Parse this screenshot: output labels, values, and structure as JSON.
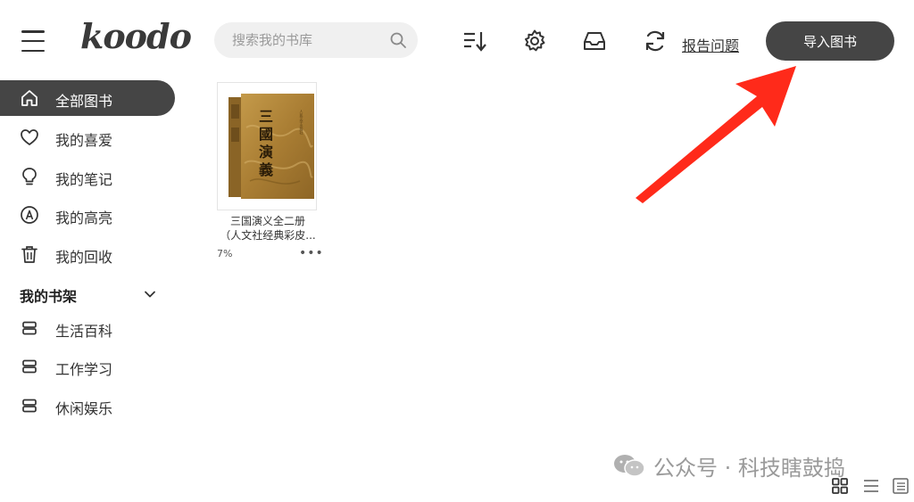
{
  "app": {
    "logo_text": "koodo"
  },
  "search": {
    "placeholder": "搜索我的书库"
  },
  "toolbar": {
    "sort_icon": "sort-icon",
    "settings_icon": "gear-icon",
    "inbox_icon": "inbox-icon",
    "sync_icon": "sync-icon",
    "report_label": "报告问题",
    "import_label": "导入图书"
  },
  "sidebar": {
    "items": [
      {
        "label": "全部图书",
        "icon": "home-icon",
        "active": true
      },
      {
        "label": "我的喜爱",
        "icon": "heart-icon"
      },
      {
        "label": "我的笔记",
        "icon": "bulb-icon"
      },
      {
        "label": "我的高亮",
        "icon": "highlight-icon"
      },
      {
        "label": "我的回收",
        "icon": "trash-icon"
      }
    ],
    "shelf_title": "我的书架",
    "shelves": [
      {
        "label": "生活百科",
        "icon": "shelf-icon"
      },
      {
        "label": "工作学习",
        "icon": "shelf-icon"
      },
      {
        "label": "休闲娱乐",
        "icon": "shelf-icon"
      }
    ]
  },
  "books": [
    {
      "title_line1": "三国演义全二册",
      "title_line2": "（人文社经典彩皮...",
      "progress": "7%",
      "more": "•••",
      "cover_text": "三國演義"
    }
  ],
  "watermark": {
    "text": "公众号 · 科技瞎鼓捣"
  },
  "colors": {
    "accent": "#454545",
    "arrow": "#ff2a1a",
    "cover": "#b08436"
  }
}
